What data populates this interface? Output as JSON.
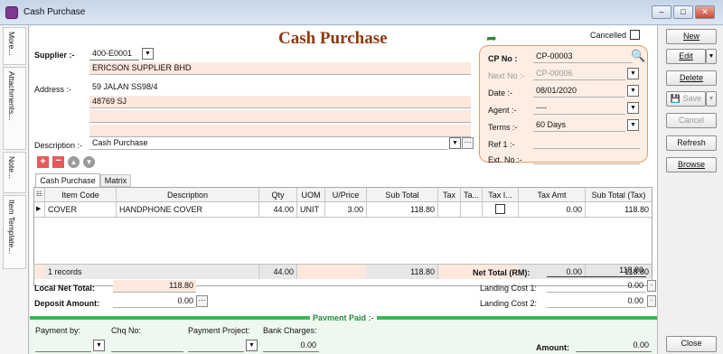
{
  "window": {
    "title": "Cash Purchase",
    "min": "–",
    "max": "□",
    "close": "✕"
  },
  "side_tabs": [
    "More...",
    "Attachments...",
    "Note...",
    "Item Template..."
  ],
  "form": {
    "title": "Cash Purchase",
    "cancelled_label": "Cancelled",
    "supplier_label": "Supplier :-",
    "supplier_code": "400-E0001",
    "supplier_name": "ERICSON SUPPLIER BHD",
    "address_label": "Address :-",
    "address_line1": "59 JALAN SS98/4",
    "address_line2": "48769 SJ",
    "description_label": "Description :-",
    "description": "Cash Purchase",
    "cp": {
      "cp_no_label": "CP No :",
      "cp_no": "CP-00003",
      "next_no_label": "Next No :-",
      "next_no": "CP-00006",
      "date_label": "Date :-",
      "date": "08/01/2020",
      "agent_label": "Agent :-",
      "agent": "----",
      "terms_label": "Terms :-",
      "terms": "60 Days",
      "ref1_label": "Ref 1 :-",
      "ref1": "",
      "extno_label": "Ext. No :-",
      "extno": ""
    },
    "tabs": [
      "Cash Purchase",
      "Matrix"
    ],
    "columns": [
      "Item Code",
      "Description",
      "Qty",
      "UOM",
      "U/Price",
      "Sub Total",
      "Tax",
      "Ta...",
      "Tax I...",
      "Tax Amt",
      "Sub Total (Tax)"
    ],
    "rows": [
      {
        "item_code": "COVER",
        "description": "HANDPHONE COVER",
        "qty": "44.00",
        "uom": "UNIT",
        "uprice": "3.00",
        "subtotal": "118.80",
        "tax": "",
        "ta": "",
        "taxamt": "0.00",
        "subtotal_tax": "118.80"
      }
    ],
    "footer": {
      "records": "1 records",
      "qty": "44.00",
      "subtotal": "118.80",
      "taxamt": "0.00",
      "subtotal_tax": "118.80"
    },
    "local_net_total_label": "Local Net Total:",
    "local_net_total": "118.80",
    "deposit_label": "Deposit Amount:",
    "deposit": "0.00",
    "net_total_label": "Net Total (RM):",
    "net_total": "118.80",
    "landing1_label": "Landing Cost 1:",
    "landing1": "0.00",
    "landing2_label": "Landing Cost 2:",
    "landing2": "0.00",
    "payment_paid_label": "Payment Paid :-",
    "payment_by_label": "Payment by:",
    "chq_label": "Chq No:",
    "project_label": "Payment Project:",
    "bank_label": "Bank Charges:",
    "bank_charges": "0.00",
    "amount_label": "Amount:",
    "amount": "0.00"
  },
  "buttons": {
    "new": "New",
    "edit": "Edit",
    "delete": "Delete",
    "save": "Save",
    "cancel": "Cancel",
    "refresh": "Refresh",
    "browse": "Browse",
    "close": "Close"
  }
}
